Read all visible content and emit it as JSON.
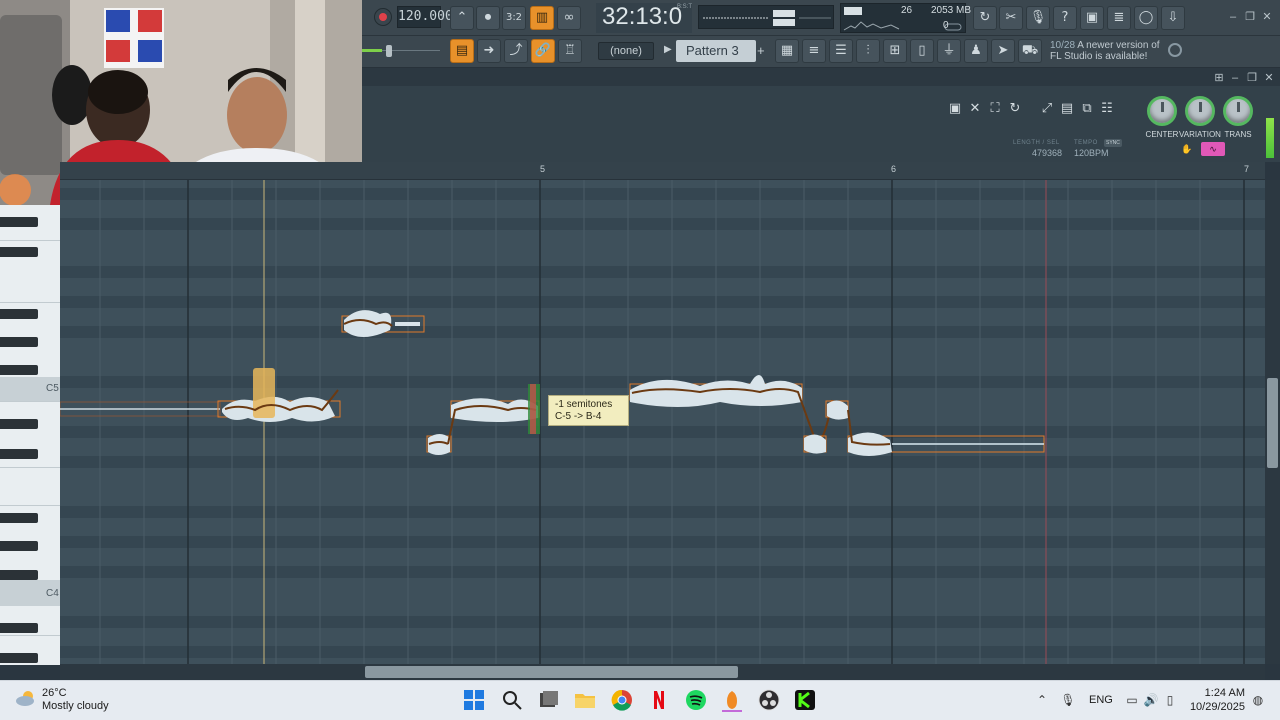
{
  "transport": {
    "tempo": "120.000",
    "song_position": "32:13:0",
    "position_unit": "B:S:T",
    "cpu": "26",
    "memory": "2053 MB",
    "polyphony": "0"
  },
  "pattern": {
    "channel_select": "(none)",
    "selected_pattern": "Pattern 3",
    "add_symbol": "+"
  },
  "hint": {
    "counter": "10/28",
    "message_line1": "A newer version of",
    "message_line2": "FL Studio is available!"
  },
  "editor": {
    "knobs": [
      "CENTER",
      "VARIATION",
      "TRANS"
    ],
    "length_label": "LENGTH / SEL",
    "length_value": "479368",
    "tempo_label": "TEMPO",
    "sync_label": "SYNC",
    "tempo_value": "120BPM"
  },
  "ruler": {
    "bars": [
      "5",
      "6",
      "7"
    ]
  },
  "keyboard": {
    "c5": "C5",
    "c4": "C4"
  },
  "tooltip": {
    "line1": "-1 semitones",
    "line2": "C-5 -> B-4"
  },
  "taskbar": {
    "weather_temp": "26°C",
    "weather_desc": "Mostly cloudy",
    "language": "ENG",
    "time": "1:24 AM",
    "date": "10/29/2025",
    "apps": [
      "start-icon",
      "search-icon",
      "task-view-icon",
      "file-explorer-icon",
      "chrome-icon",
      "netflix-icon",
      "spotify-icon",
      "fl-studio-icon",
      "obs-icon",
      "kick-icon"
    ]
  },
  "colors": {
    "accent_orange": "#e8912a",
    "note_outline": "#e07a2a",
    "pitch_curve": "#6b3a12",
    "knob_ring": "#55b860",
    "grid_bg": "#3c4d58",
    "tooltip_bg": "#f2edbf",
    "pink_button": "#e158b7"
  }
}
